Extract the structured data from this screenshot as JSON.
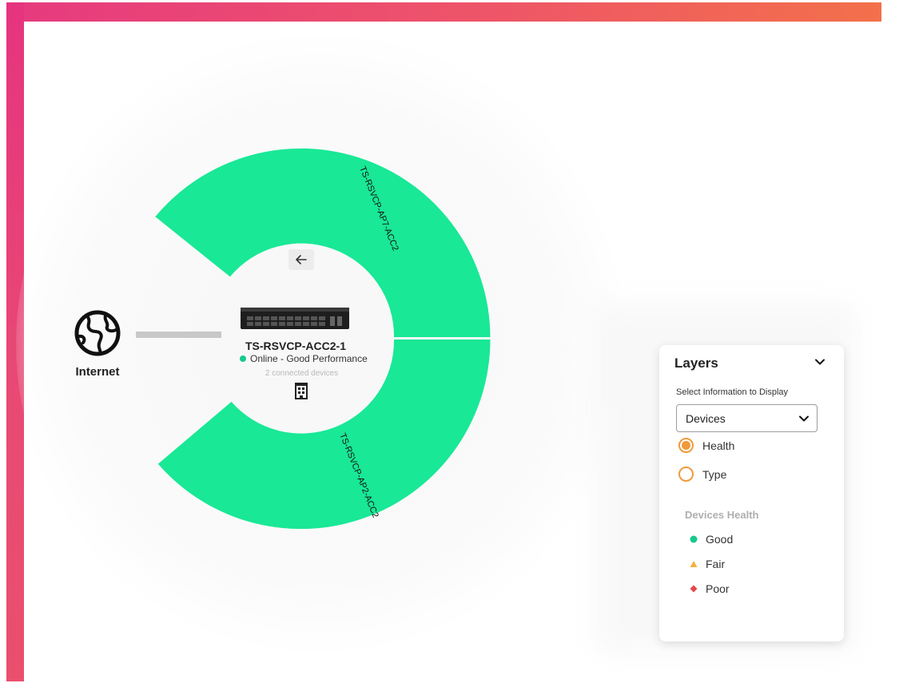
{
  "colors": {
    "accent_gradient_start": "#e6347f",
    "accent_gradient_end": "#f3704a",
    "ring_green": "#19e896",
    "status_good": "#17c98a",
    "status_fair": "#f2b33d",
    "status_poor": "#e5484d",
    "radio_orange": "#f09a3a"
  },
  "topology": {
    "internet": {
      "icon": "globe-icon",
      "label": "Internet"
    },
    "back_button_icon": "back-arrow-icon",
    "switch": {
      "name": "TS-RSVCP-ACC2-1",
      "status": "Online - Good Performance",
      "connected": "2 connected devices",
      "site_icon": "building-icon"
    },
    "segments": [
      {
        "label": "TS-RSVCP-AP7-ACC2",
        "health": "Good"
      },
      {
        "label": "TS-RSVCP-AP2-ACC2",
        "health": "Good"
      }
    ]
  },
  "layers_panel": {
    "title": "Layers",
    "subtitle": "Select Information to Display",
    "select_value": "Devices",
    "options": [
      {
        "label": "Health",
        "selected": true
      },
      {
        "label": "Type",
        "selected": false
      }
    ],
    "legend_title": "Devices Health",
    "legend": [
      {
        "label": "Good",
        "shape": "circle"
      },
      {
        "label": "Fair",
        "shape": "triangle"
      },
      {
        "label": "Poor",
        "shape": "diamond"
      }
    ]
  }
}
